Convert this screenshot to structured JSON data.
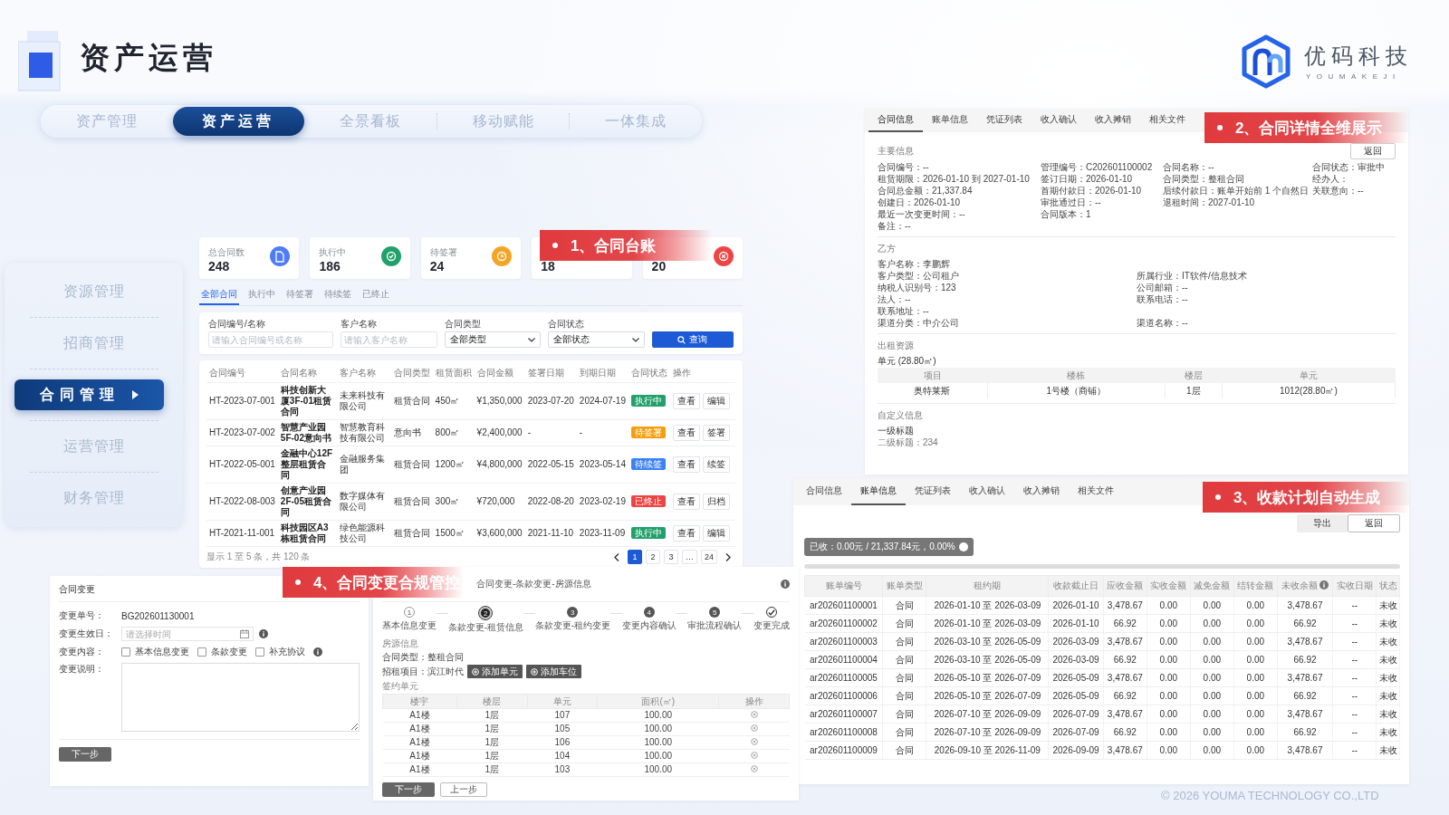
{
  "header": {
    "title": "资产运营"
  },
  "brand": {
    "name": "优码科技",
    "pinyin": "YOUMAKEJI"
  },
  "nav_tabs": [
    {
      "label": "资产管理",
      "selected": false
    },
    {
      "label": "资产运营",
      "selected": true
    },
    {
      "label": "全景看板",
      "selected": false
    },
    {
      "label": "移动赋能",
      "selected": false
    },
    {
      "label": "一体集成",
      "selected": false
    }
  ],
  "sidebar": {
    "items": [
      {
        "label": "资源管理",
        "selected": false
      },
      {
        "label": "招商管理",
        "selected": false
      },
      {
        "label": "合同管理",
        "selected": true
      },
      {
        "label": "运营管理",
        "selected": false
      },
      {
        "label": "财务管理",
        "selected": false
      }
    ]
  },
  "ledger": {
    "callout": "1、合同台账",
    "stats": [
      {
        "label": "总合同数",
        "value": "248",
        "color": "#4f7cf7"
      },
      {
        "label": "执行中",
        "value": "186",
        "color": "#22a06b"
      },
      {
        "label": "待签署",
        "value": "24",
        "color": "#f5a524"
      },
      {
        "value": "18"
      },
      {
        "value": "20",
        "color": "#ef4444"
      }
    ],
    "tabs": [
      {
        "label": "全部合同",
        "selected": true
      },
      {
        "label": "执行中",
        "selected": false
      },
      {
        "label": "待签署",
        "selected": false
      },
      {
        "label": "待续签",
        "selected": false
      },
      {
        "label": "已终止",
        "selected": false
      }
    ],
    "filters": [
      {
        "kind": "input",
        "label": "合同编号/名称",
        "placeholder": "请输入合同编号或名称"
      },
      {
        "kind": "input",
        "label": "客户名称",
        "placeholder": "请输入客户名称"
      },
      {
        "kind": "select",
        "label": "合同类型",
        "value": "全部类型"
      },
      {
        "kind": "select",
        "label": "合同状态",
        "value": "全部状态"
      }
    ],
    "search_button": "查询",
    "columns": [
      "合同编号",
      "合同名称",
      "客户名称",
      "合同类型",
      "租赁面积",
      "合同金额",
      "签署日期",
      "到期日期",
      "合同状态",
      "操作"
    ],
    "rows": [
      {
        "cells": [
          "HT-2023-07-001",
          "科技创新大厦3F-01租赁合同",
          "未来科技有限公司",
          "租赁合同",
          "450㎡",
          "¥1,350,000",
          "2023-07-20",
          "2024-07-19"
        ],
        "status": "执行中",
        "color": "#22a06b",
        "actions": [
          "查看",
          "编辑"
        ]
      },
      {
        "cells": [
          "HT-2023-07-002",
          "智慧产业园5F-02意向书",
          "智慧教育科技有限公司",
          "意向书",
          "800㎡",
          "¥2,400,000",
          "-",
          "-"
        ],
        "status": "待签署",
        "color": "#f59e0b",
        "actions": [
          "查看",
          "签署"
        ]
      },
      {
        "cells": [
          "HT-2022-05-001",
          "金融中心12F整层租赁合同",
          "金融服务集团",
          "租赁合同",
          "1200㎡",
          "¥4,800,000",
          "2022-05-15",
          "2023-05-14"
        ],
        "status": "待续签",
        "color": "#3b82f6",
        "actions": [
          "查看",
          "续签"
        ]
      },
      {
        "cells": [
          "HT-2022-08-003",
          "创意产业园2F-05租赁合同",
          "数字媒体有限公司",
          "租赁合同",
          "300㎡",
          "¥720,000",
          "2022-08-20",
          "2023-02-19"
        ],
        "status": "已终止",
        "color": "#ef4444",
        "actions": [
          "查看",
          "归档"
        ]
      },
      {
        "cells": [
          "HT-2021-11-001",
          "科技园区A3栋租赁合同",
          "绿色能源科技公司",
          "租赁合同",
          "1500㎡",
          "¥3,600,000",
          "2021-11-10",
          "2023-11-09"
        ],
        "status": "执行中",
        "color": "#22a06b",
        "actions": [
          "查看",
          "编辑"
        ]
      }
    ],
    "summary": "显示 1 至 5 条，共 120 条",
    "pages": [
      {
        "label": "1",
        "selected": true
      },
      {
        "label": "2",
        "selected": false
      },
      {
        "label": "3",
        "selected": false
      },
      {
        "label": "…",
        "selected": false
      },
      {
        "label": "24",
        "selected": false
      }
    ]
  },
  "detail": {
    "callout": "2、合同详情全维展示",
    "tabs": [
      {
        "label": "合同信息",
        "selected": true
      },
      {
        "label": "账单信息",
        "selected": false
      },
      {
        "label": "凭证列表",
        "selected": false
      },
      {
        "label": "收入确认",
        "selected": false
      },
      {
        "label": "收入摊销",
        "selected": false
      },
      {
        "label": "相关文件",
        "selected": false
      }
    ],
    "back_button": "返回",
    "sections": [
      {
        "kind": "fields",
        "title": "主要信息",
        "rows": [
          [
            "合同编号：--",
            "管理编号：C202601100002",
            "合同名称：--",
            "合同状态：审批中"
          ],
          [
            "租赁期限：2026-01-10 到 2027-01-10",
            "签订日期：2026-01-10",
            "合同类型：整租合同",
            "经办人："
          ],
          [
            "合同总金额：21,337.84",
            "首期付款日：2026-01-10",
            "后续付款日：账单开始前 1 个自然日",
            "关联意向：--"
          ],
          [
            "创建日：2026-01-10",
            "审批通过日：--",
            "退租时间：2027-01-10"
          ],
          [
            "最近一次变更时间：--",
            "合同版本：1"
          ],
          [
            "备注：--"
          ]
        ]
      },
      {
        "kind": "fields",
        "title": "乙方",
        "rows": [
          [
            "客户名称：李鹏辉"
          ],
          [
            "客户类型：公司租户",
            "所属行业：IT软件/信息技术"
          ],
          [
            "纳税人识别号：123",
            "公司邮箱：--"
          ],
          [
            "法人：--",
            "联系电话：--"
          ],
          [
            "联系地址：--"
          ],
          [
            "渠道分类：中介公司",
            "渠道名称：--"
          ]
        ]
      },
      {
        "kind": "table",
        "title": "出租资源",
        "subtitle": "单元 (28.80㎡)",
        "columns": [
          "项目",
          "楼栋",
          "楼层",
          "单元"
        ],
        "rows": [
          [
            "奥特莱斯",
            "1号楼（商铺）",
            "1层",
            "1012(28.80㎡)"
          ]
        ]
      },
      {
        "kind": "lines",
        "title": "自定义信息",
        "lines": [
          "一级标题",
          "二级标题：234"
        ]
      }
    ]
  },
  "bills": {
    "callout": "3、收款计划自动生成",
    "tabs": [
      {
        "label": "合同信息",
        "selected": false
      },
      {
        "label": "账单信息",
        "selected": true
      },
      {
        "label": "凭证列表",
        "selected": false
      },
      {
        "label": "收入确认",
        "selected": false
      },
      {
        "label": "收入摊销",
        "selected": false
      },
      {
        "label": "相关文件",
        "selected": false
      }
    ],
    "buttons": [
      {
        "label": "导出",
        "kind": "filled"
      },
      {
        "label": "返回",
        "kind": "outline"
      }
    ],
    "summary": "已收：0.00元 / 21,337.84元，0.00%",
    "progress": {
      "level": 0
    },
    "columns": [
      {
        "label": "账单编号",
        "help": false
      },
      {
        "label": "账单类型",
        "help": false
      },
      {
        "label": "租约期",
        "help": false
      },
      {
        "label": "收款截止日",
        "help": false
      },
      {
        "label": "应收金额",
        "help": false
      },
      {
        "label": "实收金额",
        "help": false
      },
      {
        "label": "减免金额",
        "help": false
      },
      {
        "label": "结转金额",
        "help": false
      },
      {
        "label": "未收余额",
        "help": true
      },
      {
        "label": "实收日期",
        "help": false
      },
      {
        "label": "状态",
        "help": false
      }
    ],
    "rows": [
      [
        "ar202601100001",
        "合同",
        "2026-01-10 至 2026-03-09",
        "2026-01-10",
        "3,478.67",
        "0.00",
        "0.00",
        "0.00",
        "3,478.67",
        "--",
        "未收"
      ],
      [
        "ar202601100002",
        "合同",
        "2026-01-10 至 2026-03-09",
        "2026-01-10",
        "66.92",
        "0.00",
        "0.00",
        "0.00",
        "66.92",
        "--",
        "未收"
      ],
      [
        "ar202601100003",
        "合同",
        "2026-03-10 至 2026-05-09",
        "2026-03-09",
        "3,478.67",
        "0.00",
        "0.00",
        "0.00",
        "3,478.67",
        "--",
        "未收"
      ],
      [
        "ar202601100004",
        "合同",
        "2026-03-10 至 2026-05-09",
        "2026-03-09",
        "66.92",
        "0.00",
        "0.00",
        "0.00",
        "66.92",
        "--",
        "未收"
      ],
      [
        "ar202601100005",
        "合同",
        "2026-05-10 至 2026-07-09",
        "2026-05-09",
        "3,478.67",
        "0.00",
        "0.00",
        "0.00",
        "3,478.67",
        "--",
        "未收"
      ],
      [
        "ar202601100006",
        "合同",
        "2026-05-10 至 2026-07-09",
        "2026-05-09",
        "66.92",
        "0.00",
        "0.00",
        "0.00",
        "66.92",
        "--",
        "未收"
      ],
      [
        "ar202601100007",
        "合同",
        "2026-07-10 至 2026-09-09",
        "2026-07-09",
        "3,478.67",
        "0.00",
        "0.00",
        "0.00",
        "3,478.67",
        "--",
        "未收"
      ],
      [
        "ar202601100008",
        "合同",
        "2026-07-10 至 2026-09-09",
        "2026-07-09",
        "66.92",
        "0.00",
        "0.00",
        "0.00",
        "66.92",
        "--",
        "未收"
      ],
      [
        "ar202601100009",
        "合同",
        "2026-09-10 至 2026-11-09",
        "2026-09-09",
        "3,478.67",
        "0.00",
        "0.00",
        "0.00",
        "3,478.67",
        "--",
        "未收"
      ]
    ]
  },
  "change_form": {
    "callout": "4、合同变更合规管控",
    "title": "合同变更",
    "fields": [
      {
        "kind": "text",
        "label": "变更单号：",
        "value": "BG202601130001"
      },
      {
        "kind": "date",
        "label": "变更生效日：",
        "placeholder": "请选择时间"
      },
      {
        "kind": "checks",
        "label": "变更内容：",
        "options": [
          {
            "label": "基本信息变更",
            "checked": false
          },
          {
            "label": "条款变更",
            "checked": false
          },
          {
            "label": "补充协议",
            "checked": false
          }
        ]
      },
      {
        "kind": "textarea",
        "label": "变更说明："
      }
    ],
    "next_button": "下一步"
  },
  "change_steps": {
    "breadcrumb": "合同变更-条款变更-房源信息",
    "steps": [
      {
        "number": "1",
        "label": "基本信息变更",
        "selected": false,
        "completed": true
      },
      {
        "number": "2",
        "label": "条款变更-租赁信息",
        "selected": true,
        "completed": false
      },
      {
        "number": "3",
        "label": "条款变更-租约变更",
        "selected": false,
        "completed": false
      },
      {
        "number": "4",
        "label": "变更内容确认",
        "selected": false,
        "completed": false
      },
      {
        "number": "5",
        "label": "审批流程确认",
        "selected": false,
        "completed": false
      },
      {
        "label": "变更完成",
        "selected": false,
        "completed": false
      }
    ],
    "section_title": "房源信息",
    "contract_type": "合同类型：整租合同",
    "project": "招租项目：滨江时代",
    "add_buttons": [
      "添加单元",
      "添加车位"
    ],
    "table_title": "签约单元",
    "columns": [
      "楼宇",
      "楼层",
      "单元",
      "面积(㎡)",
      "操作"
    ],
    "rows": [
      [
        "A1楼",
        "1层",
        "107",
        "100.00"
      ],
      [
        "A1楼",
        "1层",
        "105",
        "100.00"
      ],
      [
        "A1楼",
        "1层",
        "106",
        "100.00"
      ],
      [
        "A1楼",
        "1层",
        "104",
        "100.00"
      ],
      [
        "A1楼",
        "1层",
        "103",
        "100.00"
      ]
    ],
    "buttons": [
      {
        "label": "下一步",
        "kind": "filled"
      },
      {
        "label": "上一步",
        "kind": "outline"
      }
    ]
  },
  "footer": "© 2026 YOUMA TECHNOLOGY CO.,LTD"
}
